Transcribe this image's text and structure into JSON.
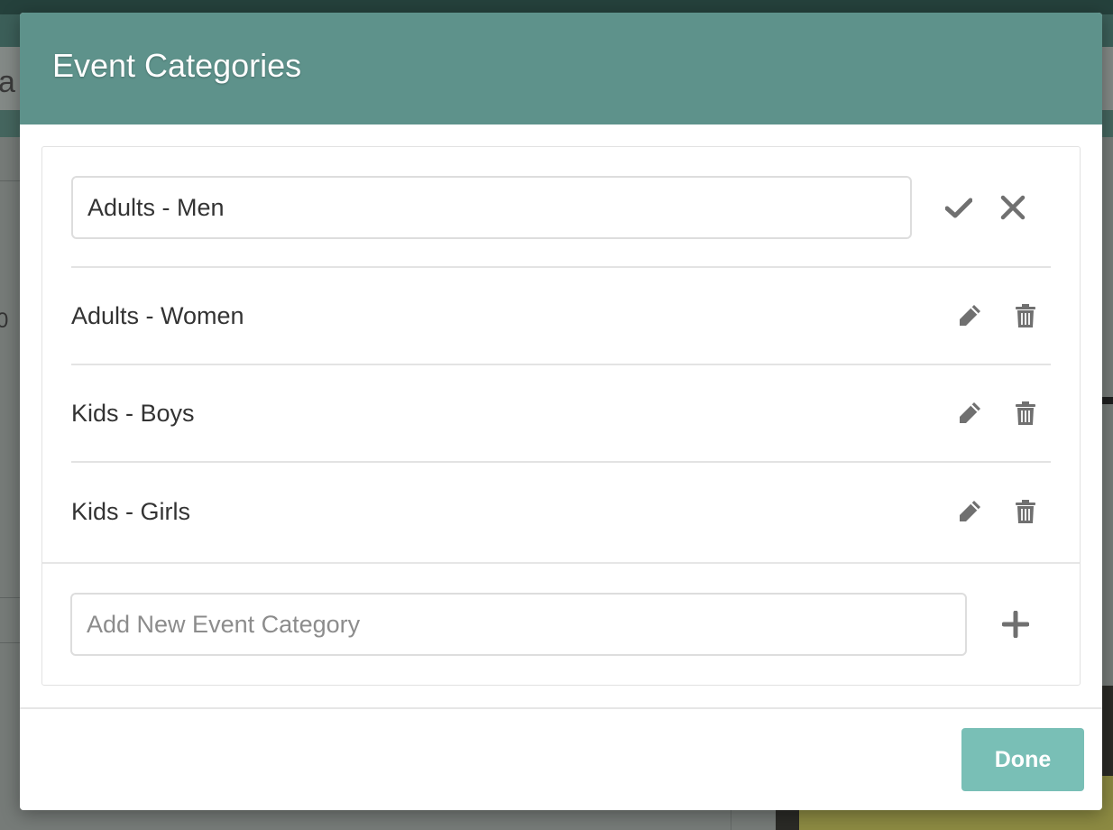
{
  "background": {
    "header_partial_text": "a",
    "side_partial_text": "0"
  },
  "modal": {
    "title": "Event Categories",
    "editing": {
      "value": "Adults - Men",
      "confirm_icon": "check-icon",
      "cancel_icon": "close-icon"
    },
    "categories": [
      {
        "label": "Adults - Women",
        "edit_icon": "pencil-icon",
        "delete_icon": "trash-icon"
      },
      {
        "label": "Kids - Boys",
        "edit_icon": "pencil-icon",
        "delete_icon": "trash-icon"
      },
      {
        "label": "Kids - Girls",
        "edit_icon": "pencil-icon",
        "delete_icon": "trash-icon"
      }
    ],
    "add": {
      "placeholder": "Add New Event Category",
      "value": "",
      "icon": "plus-icon"
    },
    "done_label": "Done"
  },
  "colors": {
    "header": "#5e928b",
    "done_button": "#79bfb6",
    "icon": "#707070"
  }
}
